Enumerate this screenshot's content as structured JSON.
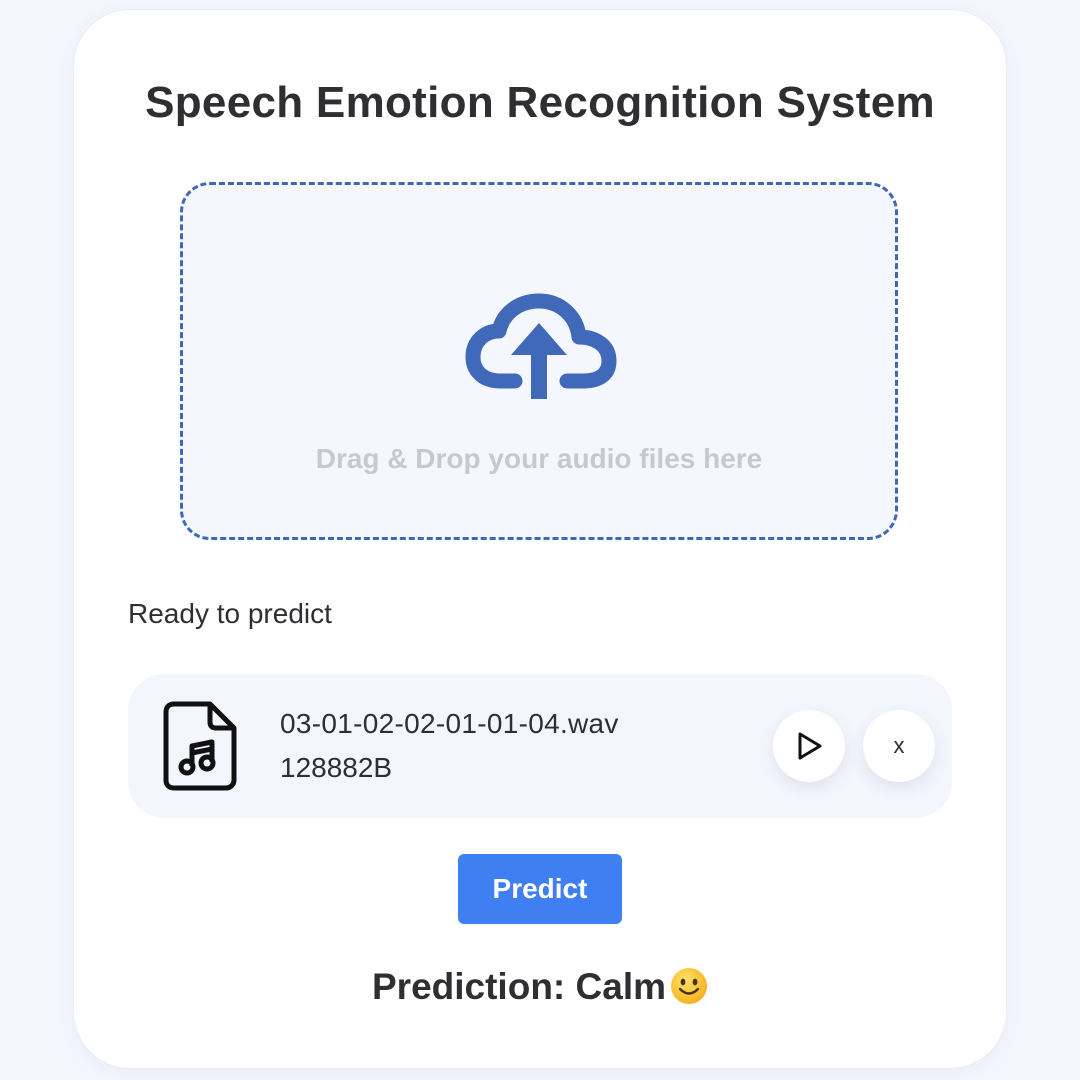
{
  "header": {
    "title": "Speech Emotion Recognition System"
  },
  "dropzone": {
    "text": "Drag & Drop your audio files here",
    "icon": "cloud-upload-icon",
    "border_color": "#3f67b4"
  },
  "status": {
    "text": "Ready to predict"
  },
  "file": {
    "name": "03-01-02-02-01-01-04.wav",
    "size": "128882B",
    "icon": "audio-file-icon",
    "play_icon": "play-icon",
    "remove_label": "x"
  },
  "predict_button": {
    "label": "Predict",
    "color": "#3f7ff1"
  },
  "prediction": {
    "text": "Prediction: Calm",
    "emoji_icon": "slightly-smiling-face-icon"
  }
}
